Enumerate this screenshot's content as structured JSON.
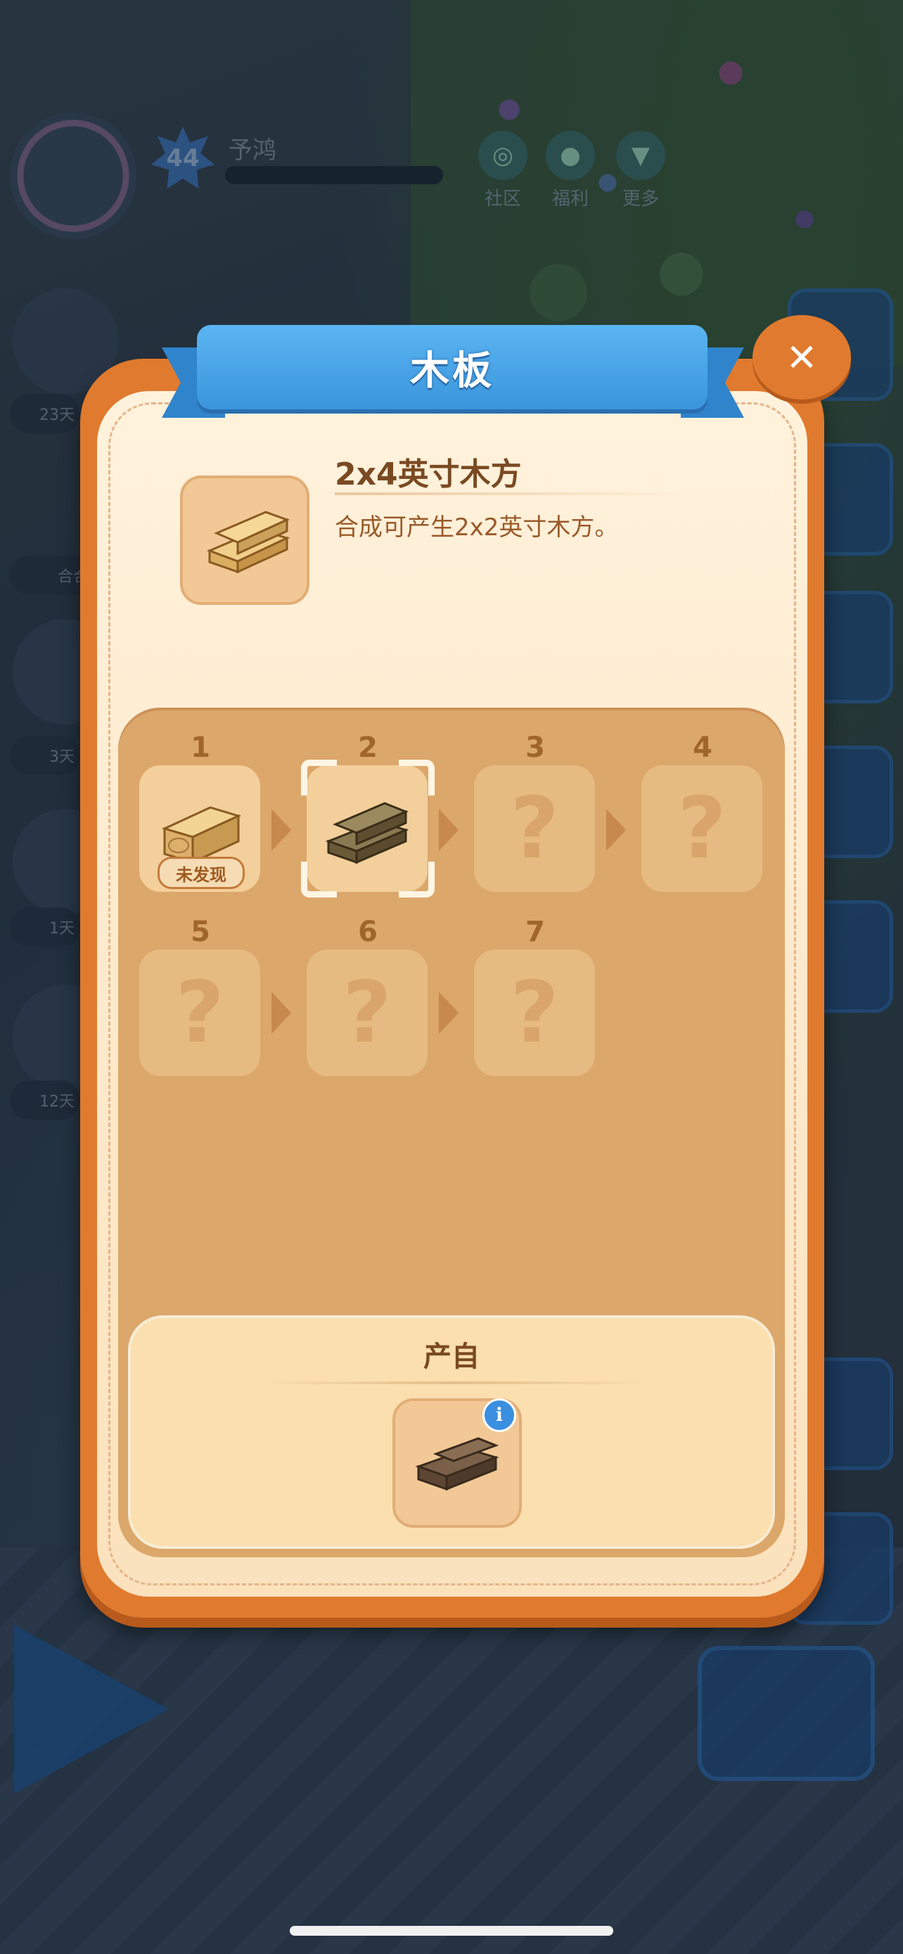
{
  "hud": {
    "level": "44",
    "player_name": "予鸿",
    "buttons": [
      {
        "label": "社区",
        "icon": "community-icon"
      },
      {
        "label": "福利",
        "icon": "welfare-icon"
      },
      {
        "label": "更多",
        "icon": "more-icon"
      }
    ],
    "timers": [
      "23天",
      "3天",
      "1天",
      "12天"
    ],
    "side_label": "合合"
  },
  "dialog": {
    "title": "木板",
    "close_icon": "close-icon",
    "item": {
      "name": "2x4英寸木方",
      "description": "合成可产生2x2英寸木方。"
    },
    "chain": {
      "cells": [
        {
          "num": "1",
          "state": "undiscovered",
          "badge": "未发现"
        },
        {
          "num": "2",
          "state": "selected"
        },
        {
          "num": "3",
          "state": "locked",
          "mark": "?"
        },
        {
          "num": "4",
          "state": "locked",
          "mark": "?"
        },
        {
          "num": "5",
          "state": "locked",
          "mark": "?"
        },
        {
          "num": "6",
          "state": "locked",
          "mark": "?"
        },
        {
          "num": "7",
          "state": "locked",
          "mark": "?"
        }
      ]
    },
    "source": {
      "title": "产自",
      "info_icon": "info-icon"
    }
  },
  "colors": {
    "dialog_border": "#e07a2e",
    "ribbon": "#3a95dc",
    "panel": "#dca76a",
    "text_brown": "#7a4a22"
  }
}
